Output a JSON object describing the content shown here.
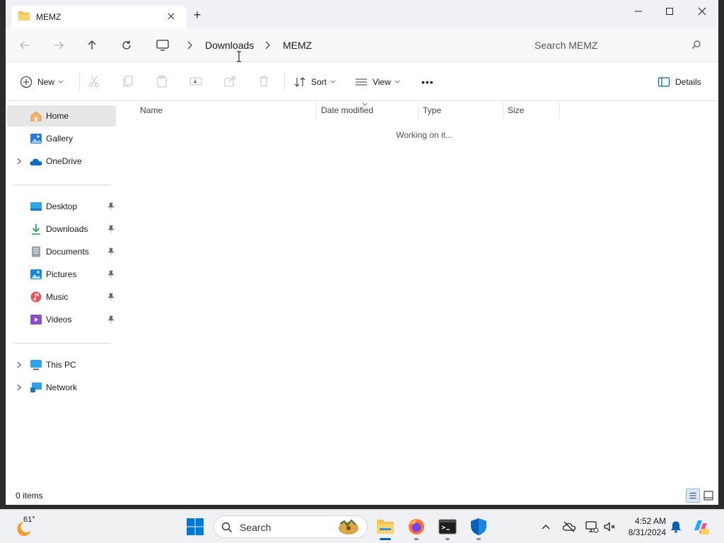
{
  "window": {
    "tab_title": "MEMZ",
    "new_tab_label": "+"
  },
  "address": {
    "breadcrumb": [
      "Downloads",
      "MEMZ"
    ],
    "search_placeholder": "Search MEMZ"
  },
  "commandbar": {
    "new_label": "New",
    "sort_label": "Sort",
    "view_label": "View",
    "more_label": "•••",
    "details_label": "Details"
  },
  "sidebar": {
    "top_items": [
      {
        "label": "Home",
        "icon": "home-icon",
        "active": true
      },
      {
        "label": "Gallery",
        "icon": "gallery-icon"
      },
      {
        "label": "OneDrive",
        "icon": "cloud-icon",
        "expandable": true
      }
    ],
    "pinned_items": [
      {
        "label": "Desktop",
        "icon": "desktop-icon"
      },
      {
        "label": "Downloads",
        "icon": "download-icon"
      },
      {
        "label": "Documents",
        "icon": "documents-icon"
      },
      {
        "label": "Pictures",
        "icon": "pictures-icon"
      },
      {
        "label": "Music",
        "icon": "music-icon"
      },
      {
        "label": "Videos",
        "icon": "videos-icon"
      }
    ],
    "bottom_items": [
      {
        "label": "This PC",
        "icon": "pc-icon",
        "expandable": true
      },
      {
        "label": "Network",
        "icon": "network-icon",
        "expandable": true
      }
    ]
  },
  "main": {
    "columns": [
      "Name",
      "Date modified",
      "Type",
      "Size"
    ],
    "loading_text": "Working on it..."
  },
  "status": {
    "item_count": "0 items"
  },
  "taskbar": {
    "weather_temp": "61°",
    "search_label": "Search",
    "clock_time": "4:52 AM",
    "clock_date": "8/31/2024"
  },
  "colors": {
    "accent": "#005fb8",
    "folder": "#f2c14e",
    "windows_blue": "#0078d4"
  }
}
